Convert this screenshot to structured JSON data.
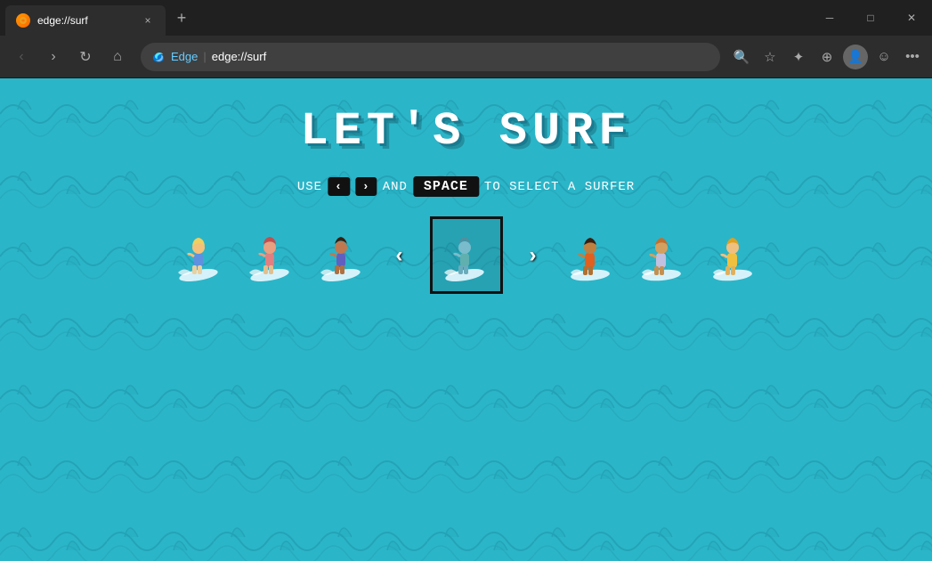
{
  "titleBar": {
    "tab": {
      "favicon_color": "#e8a020",
      "title": "edge://surf",
      "close_label": "×"
    },
    "newTab_label": "+",
    "controls": {
      "minimize": "─",
      "maximize": "□",
      "close": "✕"
    }
  },
  "addressBar": {
    "back_label": "‹",
    "forward_label": "›",
    "reload_label": "↻",
    "home_label": "⌂",
    "edge_text": "Edge",
    "separator": "|",
    "url": "edge://surf",
    "search_label": "🔍",
    "favorite_label": "☆",
    "collections_label": "★",
    "add_label": "⊕",
    "profile_label": "👤",
    "emoji_label": "☺",
    "more_label": "…"
  },
  "game": {
    "title": "LET'S  SURF",
    "instructions": {
      "use_label": "USE",
      "left_key": "‹",
      "right_key": "›",
      "and_label": "AND",
      "space_key": "SPACE",
      "end_label": "TO SELECT A SURFER"
    },
    "surfers": [
      {
        "id": 1,
        "color_skin": "#f5c07a",
        "color_hair": "#f0d060",
        "color_suit": "#6090e0",
        "selected": false
      },
      {
        "id": 2,
        "color_skin": "#e8a080",
        "color_hair": "#c05050",
        "color_suit": "#e08080",
        "selected": false
      },
      {
        "id": 3,
        "color_skin": "#c07850",
        "color_hair": "#3a2010",
        "color_suit": "#6060c0",
        "selected": false
      },
      {
        "id": 4,
        "color_skin": "#7abccc",
        "color_hair": "#5090a0",
        "color_suit": "#60b0b0",
        "selected": true
      },
      {
        "id": 5,
        "color_skin": "#c08040",
        "color_hair": "#3a2010",
        "color_suit": "#e06020",
        "selected": false
      },
      {
        "id": 6,
        "color_skin": "#d4a060",
        "color_hair": "#c07030",
        "color_suit": "#c0c0e0",
        "selected": false
      },
      {
        "id": 7,
        "color_skin": "#f0c080",
        "color_hair": "#e0a020",
        "color_suit": "#f0c040",
        "selected": false
      }
    ],
    "nav": {
      "left": "‹",
      "right": "›"
    },
    "ocean_color": "#2bb5c8",
    "wave_dark": "#1a9ab0"
  }
}
